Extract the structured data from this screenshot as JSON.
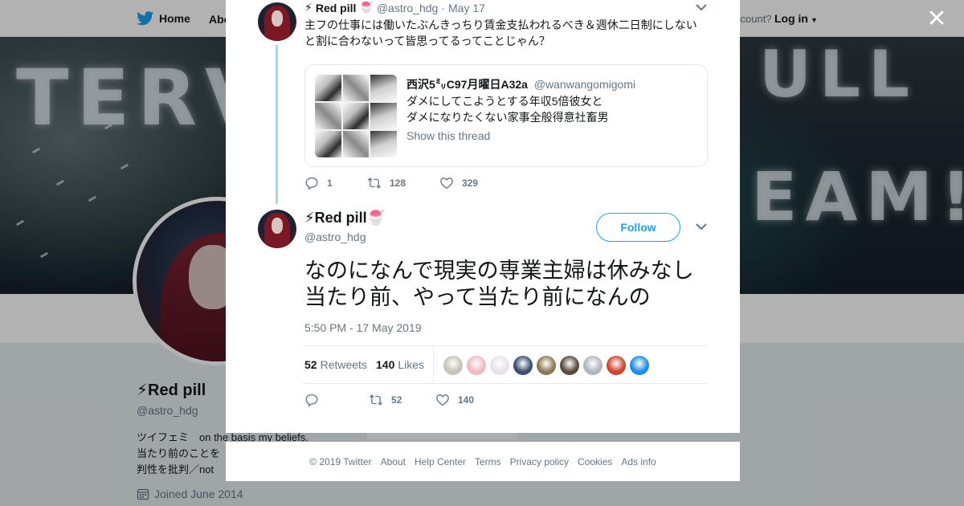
{
  "topbar": {
    "home_label": "Home",
    "about_label": "Abo",
    "account_prompt": "ccount?",
    "login_label": "Log in"
  },
  "banner": {
    "neon_left": "TERV",
    "neon_right_top": "ULL",
    "neon_right_bottom": "EAM!"
  },
  "profile": {
    "name": "Red pill",
    "handle": "@astro_hdg",
    "bio": "ツイフェミ　on the basis my beliefs.\n当たり前のことを\n判性を批判／not",
    "joined": "Joined June 2014"
  },
  "close_label": "✕",
  "parent_tweet": {
    "name": "Red pill",
    "handle": "@astro_hdg",
    "date": "May 17",
    "text": "主フの仕事には働いたぶんきっちり賃金支払われるべき＆週休二日制にしないと割に合わないって皆思ってるってことじゃん？",
    "quote": {
      "name": "西沢5㍉C97月曜日A32a",
      "handle": "@wanwangomigomi",
      "text": "ダメにしてこようとする年収5倍彼女と\nダメになりたくない家事全般得意社畜男",
      "link": "Show this thread"
    },
    "replies": "1",
    "retweets": "128",
    "likes": "329"
  },
  "main_tweet": {
    "name": "Red pill",
    "handle": "@astro_hdg",
    "follow_label": "Follow",
    "text": "なのになんで現実の専業主婦は休みなし当たり前、やって当たり前になんの",
    "timestamp": "5:50 PM - 17 May 2019",
    "retweet_count": "52",
    "retweet_label": "Retweets",
    "like_count": "140",
    "like_label": "Likes",
    "liker_colors": [
      "#c9c2b5",
      "#f0b9c0",
      "#e8e1ea",
      "#3b4f6e",
      "#8c7a55",
      "#5a4a3c",
      "#b0b6bf",
      "#d0452c",
      "#1d8ee0"
    ],
    "replies": "",
    "retweets": "52",
    "likes": "140"
  },
  "footer": {
    "links": [
      "© 2019 Twitter",
      "About",
      "Help Center",
      "Terms",
      "Privacy policy",
      "Cookies",
      "Ads info"
    ]
  },
  "colors": {
    "accent": "#1da1f2",
    "thread_line": "#a3d4f5",
    "muted": "#657786"
  },
  "icons": {
    "bolt": "⚡",
    "shaved_ice": "🍧",
    "twitter_logo": "twitter-bird"
  }
}
